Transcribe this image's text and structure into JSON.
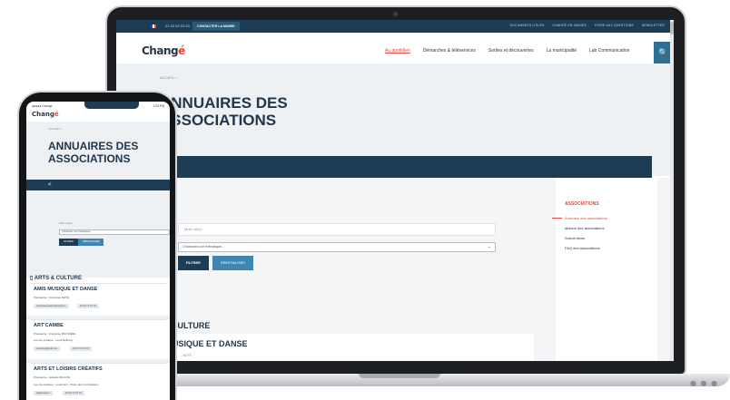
{
  "site": {
    "phone": "02 43 53 53 53",
    "contact_label": "CONTACTER LA MAIRIE",
    "top_links": [
      "DOCUMENTS UTILES",
      "CHANGÉ EN IMAGES",
      "FOIRE AUX QUESTIONS",
      "NEWSLETTER"
    ],
    "logo": "Changé",
    "nav": [
      "Au quotidien",
      "Démarches & téléservices",
      "Sorties et découvertes",
      "La municipalité",
      "Lab Communication"
    ],
    "search_icon": "🔍",
    "breadcrumb": "ACCUEIL  >",
    "title": "ANNUAIRES DES ASSOCIATIONS"
  },
  "filters": {
    "keyword_placeholder": "Mots clé(s)",
    "theme_placeholder": "Choisissez une thématique...",
    "filter_label": "FILTRER",
    "reset_label": "RÉINITIALISER"
  },
  "sidebar": {
    "title": "ASSOCIATIONS",
    "items": [
      "Annuaire des associations",
      "Maison des associations",
      "Subventions",
      "FAQ des associations"
    ]
  },
  "content": {
    "category": "& CULTURE",
    "first_assoc": "USIQUE ET DANSE",
    "first_assoc_sub": "nte : ... NÉTÉ"
  },
  "phone": {
    "status_left": "●●●●● Orange",
    "status_right": "1:20 PM",
    "back": "<",
    "category": "ARTS & CULTURE",
    "associations": [
      {
        "name": "AMIS MUSIQUE ET DANSE",
        "line": "Présidente : Françoise NÉTÉ",
        "chips": [
          "amismusiquedanse@orange.fr",
          "06 XX XX XX XX"
        ]
      },
      {
        "name": "ART'CAMBE",
        "line": "Présidente : Françoise BOUVIÈRE",
        "line2": "Lieu de pratique : Local Bethany",
        "chips": [
          "artcambe@gmail.com",
          "06 XX XX XX XX"
        ]
      },
      {
        "name": "ARTS ET LOISIRS CRÉATIFS",
        "line": "Présidente : Isabelle MOULTE",
        "line2": "Lieu de pratique : Local ALC - Place des Combattants",
        "chips": [
          "alc@orange.fr",
          "06 XX XX XX XX"
        ]
      }
    ]
  },
  "colors": {
    "navy": "#1c3d55",
    "accent": "#e8483f",
    "blue": "#3f86b5"
  }
}
